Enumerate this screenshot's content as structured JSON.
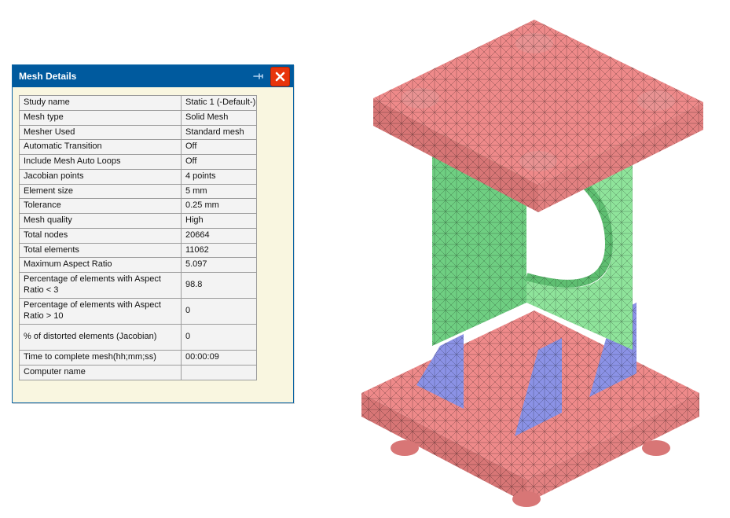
{
  "dialog": {
    "title": "Mesh Details",
    "rows": [
      {
        "label": "Study name",
        "value": "Static 1 (-Default-)"
      },
      {
        "label": "Mesh type",
        "value": "Solid Mesh"
      },
      {
        "label": "Mesher Used",
        "value": "Standard mesh"
      },
      {
        "label": "Automatic Transition",
        "value": "Off"
      },
      {
        "label": "Include Mesh Auto Loops",
        "value": "Off"
      },
      {
        "label": "Jacobian points",
        "value": "4 points"
      },
      {
        "label": "Element size",
        "value": "5 mm"
      },
      {
        "label": "Tolerance",
        "value": "0.25 mm"
      },
      {
        "label": "Mesh quality",
        "value": "High"
      },
      {
        "label": "Total nodes",
        "value": "20664"
      },
      {
        "label": "Total elements",
        "value": "11062"
      },
      {
        "label": "Maximum Aspect Ratio",
        "value": "5.097"
      },
      {
        "label": "Percentage of elements with Aspect Ratio < 3",
        "value": "98.8",
        "tall": true
      },
      {
        "label": "Percentage of elements with Aspect Ratio > 10",
        "value": "0",
        "tall": true
      },
      {
        "label": "% of distorted elements (Jacobian)",
        "value": "0",
        "tall": true
      },
      {
        "label": "Time to complete mesh(hh;mm;ss)",
        "value": "00:00:09"
      },
      {
        "label": "Computer name",
        "value": ""
      }
    ]
  },
  "model": {
    "description": "3D meshed solid part (isometric)",
    "top_plate_color": "#ef8a8a",
    "bottom_plate_color": "#ef8a8a",
    "column_color": "#7fd98f",
    "rib_color": "#8b92e6",
    "edge_color": "#222222"
  }
}
